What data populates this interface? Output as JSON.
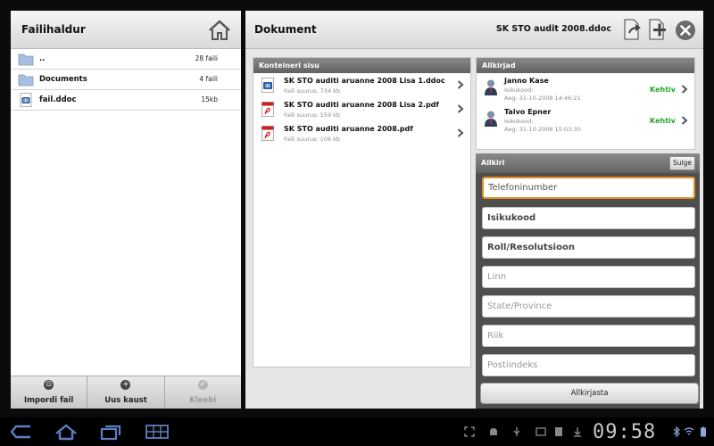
{
  "file_manager": {
    "title": "Failihaldur",
    "files": [
      {
        "name": "..",
        "meta": "28 faili",
        "icon": "folder-icon"
      },
      {
        "name": "Documents",
        "meta": "4 faili",
        "icon": "folder-icon"
      },
      {
        "name": "fail.ddoc",
        "meta": "15kb",
        "icon": "ddoc-file-icon"
      }
    ],
    "buttons": {
      "import": "Impordi fail",
      "new_folder": "Uus kaust",
      "paste": "Kleebi"
    }
  },
  "document": {
    "title": "Dokument",
    "file_name": "SK STO audit 2008.ddoc",
    "container": {
      "header": "Konteineri sisu",
      "items": [
        {
          "name": "SK STO auditi aruanne 2008 Lisa 1.ddoc",
          "size": "Faili suurus: 734 kb",
          "icon": "ddoc-file-icon"
        },
        {
          "name": "SK STO auditi aruanne 2008 Lisa 2.pdf",
          "size": "Faili suurus: 559 kb",
          "icon": "pdf-file-icon"
        },
        {
          "name": "SK STO auditi aruanne 2008.pdf",
          "size": "Faili suurus: 106 kb",
          "icon": "pdf-file-icon"
        }
      ]
    },
    "signatures": {
      "header": "Allkirjad",
      "items": [
        {
          "name": "Janno Kase",
          "id_label": "Isikukood:",
          "time": "Aeg: 31-10-2008 14:46:21",
          "status": "Kehtiv"
        },
        {
          "name": "Taivo Epner",
          "id_label": "Isikukood:",
          "time": "Aeg: 31-10-2008 15:03:30",
          "status": "Kehtiv"
        }
      ]
    },
    "sign_form": {
      "header": "Allkiri",
      "close_label": "Sulge",
      "fields": {
        "phone": "Telefoninumber",
        "personal_code": "Isikukood",
        "role": "Roll/Resolutsioon",
        "city": "Linn",
        "state": "State/Province",
        "country": "Riik",
        "postal": "Postiindeks"
      },
      "sign_label": "Allkirjasta"
    }
  },
  "system_bar": {
    "clock": "09:58"
  },
  "colors": {
    "valid_status": "#26a62a",
    "focus_border": "#e88c1f",
    "section_header": "#6f6f6f"
  }
}
